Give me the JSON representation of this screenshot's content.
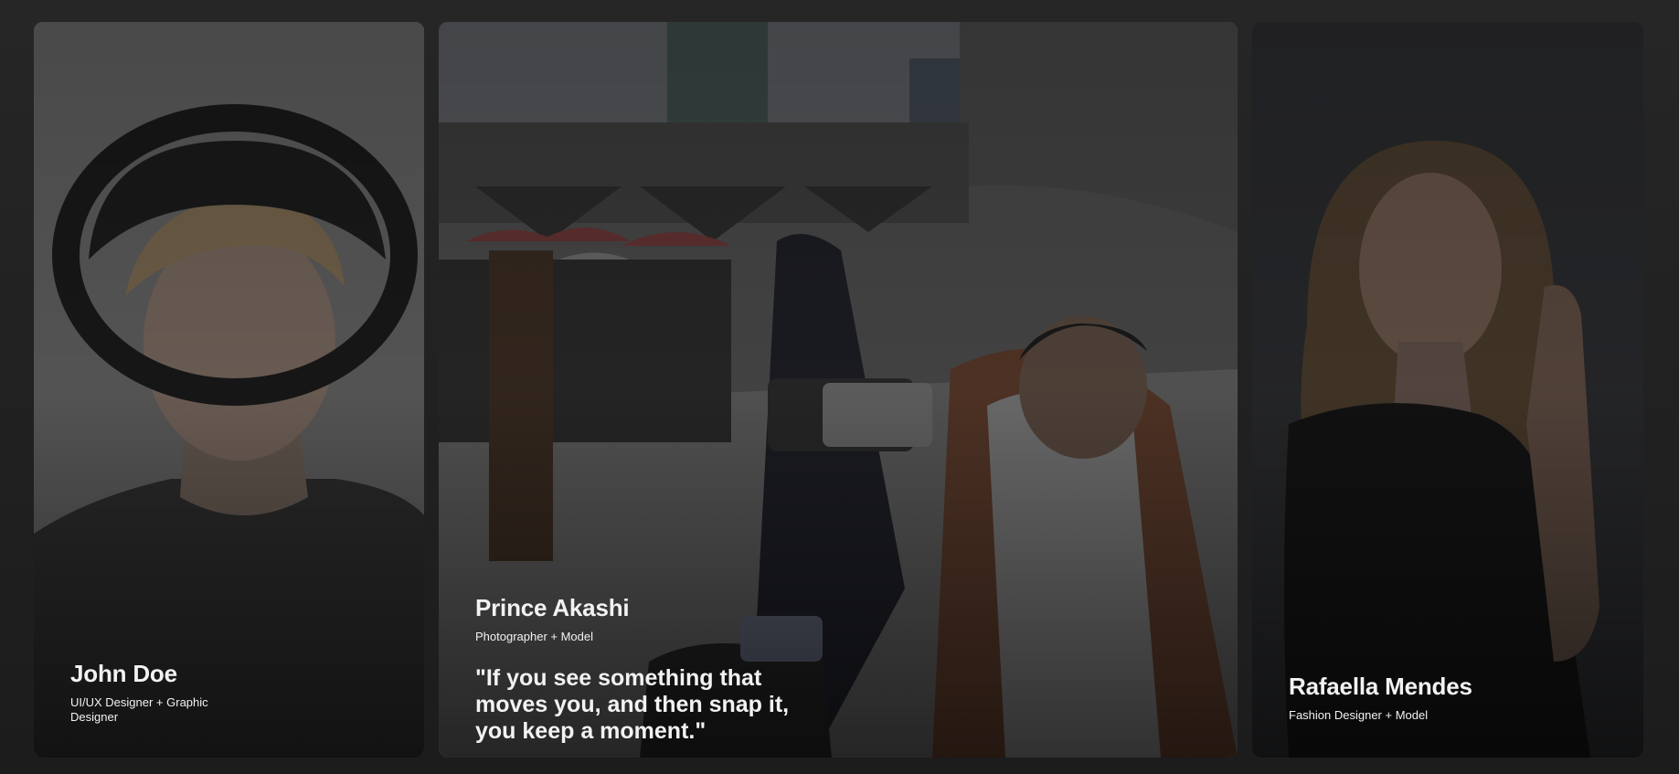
{
  "cards": [
    {
      "name": "John Doe",
      "role": "UI/UX Designer + Graphic Designer"
    },
    {
      "name": "Prince Akashi",
      "role": "Photographer + Model",
      "quote": "\"If you see something that moves you, and then snap it, you keep a moment.\""
    },
    {
      "name": "Rafaella Mendes",
      "role": "Fashion Designer + Model"
    }
  ],
  "colors": {
    "page_background": "#222222",
    "text": "#f2f2f2"
  }
}
